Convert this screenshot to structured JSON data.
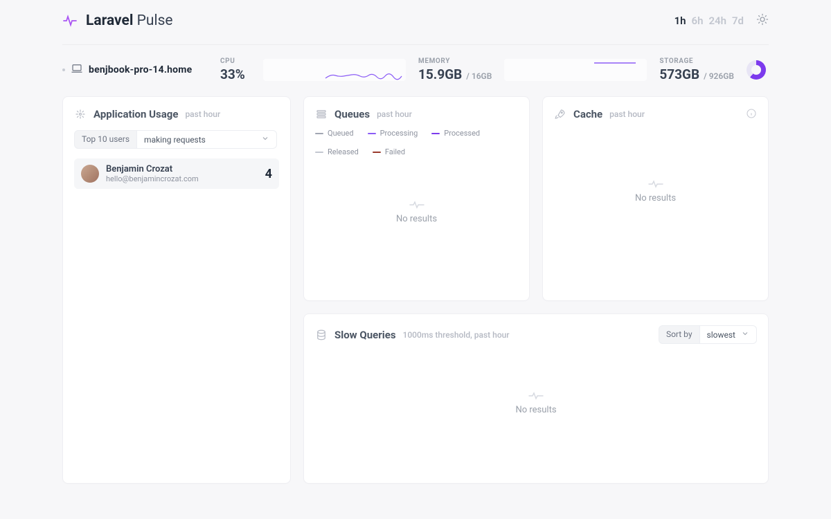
{
  "brand": {
    "strong": "Laravel",
    "light": "Pulse"
  },
  "time_ranges": {
    "items": [
      "1h",
      "6h",
      "24h",
      "7d"
    ],
    "active": "1h"
  },
  "server": {
    "name": "benjbook-pro-14.home"
  },
  "metrics": {
    "cpu": {
      "label": "CPU",
      "value": "33%"
    },
    "memory": {
      "label": "MEMORY",
      "value": "15.9GB",
      "total": "/ 16GB"
    },
    "storage": {
      "label": "STORAGE",
      "value": "573GB",
      "total": "/ 926GB"
    }
  },
  "app_usage": {
    "title": "Application Usage",
    "subtitle": "past hour",
    "filter_left": "Top 10 users",
    "filter_right": "making requests",
    "users": [
      {
        "name": "Benjamin Crozat",
        "email": "hello@benjamincrozat.com",
        "count": "4"
      }
    ]
  },
  "queues": {
    "title": "Queues",
    "subtitle": "past hour",
    "legend": [
      {
        "label": "Queued",
        "color": "#a1a6b2"
      },
      {
        "label": "Processing",
        "color": "#8b5cf6"
      },
      {
        "label": "Processed",
        "color": "#7c3aed"
      },
      {
        "label": "Released",
        "color": "#c3c7d0"
      },
      {
        "label": "Failed",
        "color": "#9a3a2c"
      }
    ],
    "empty": "No results"
  },
  "cache": {
    "title": "Cache",
    "subtitle": "past hour",
    "empty": "No results"
  },
  "slow_queries": {
    "title": "Slow Queries",
    "subtitle": "1000ms threshold, past hour",
    "sort_label": "Sort by",
    "sort_value": "slowest",
    "empty": "No results"
  }
}
